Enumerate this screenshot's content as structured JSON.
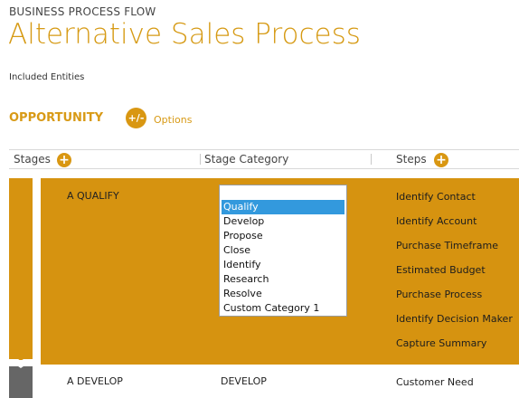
{
  "header": {
    "kicker": "BUSINESS PROCESS FLOW",
    "title": "Alternative Sales Process",
    "included_entities_label": "Included Entities"
  },
  "entity": {
    "name": "OPPORTUNITY",
    "options_button_glyph": "+/-",
    "options_label": "Options"
  },
  "columns": {
    "stages": "Stages",
    "stage_category": "Stage Category",
    "steps": "Steps"
  },
  "stages": [
    {
      "name": "A QUALIFY",
      "steps": [
        "Identify Contact",
        "Identify Account",
        "Purchase Timeframe",
        "Estimated Budget",
        "Purchase Process",
        "Identify Decision Maker",
        "Capture Summary"
      ]
    },
    {
      "name": "A DEVELOP",
      "category": "DEVELOP",
      "steps": [
        "Customer Need"
      ]
    }
  ],
  "category_dropdown": {
    "selected": "Qualify",
    "options": [
      "Qualify",
      "Develop",
      "Propose",
      "Close",
      "Identify",
      "Research",
      "Resolve",
      "Custom Category 1"
    ]
  },
  "icons": {
    "options": "plus-minus-icon",
    "add": "plus-icon"
  },
  "colors": {
    "accent": "#d69310",
    "selection": "#3399dd",
    "inactive_stage": "#666666"
  }
}
